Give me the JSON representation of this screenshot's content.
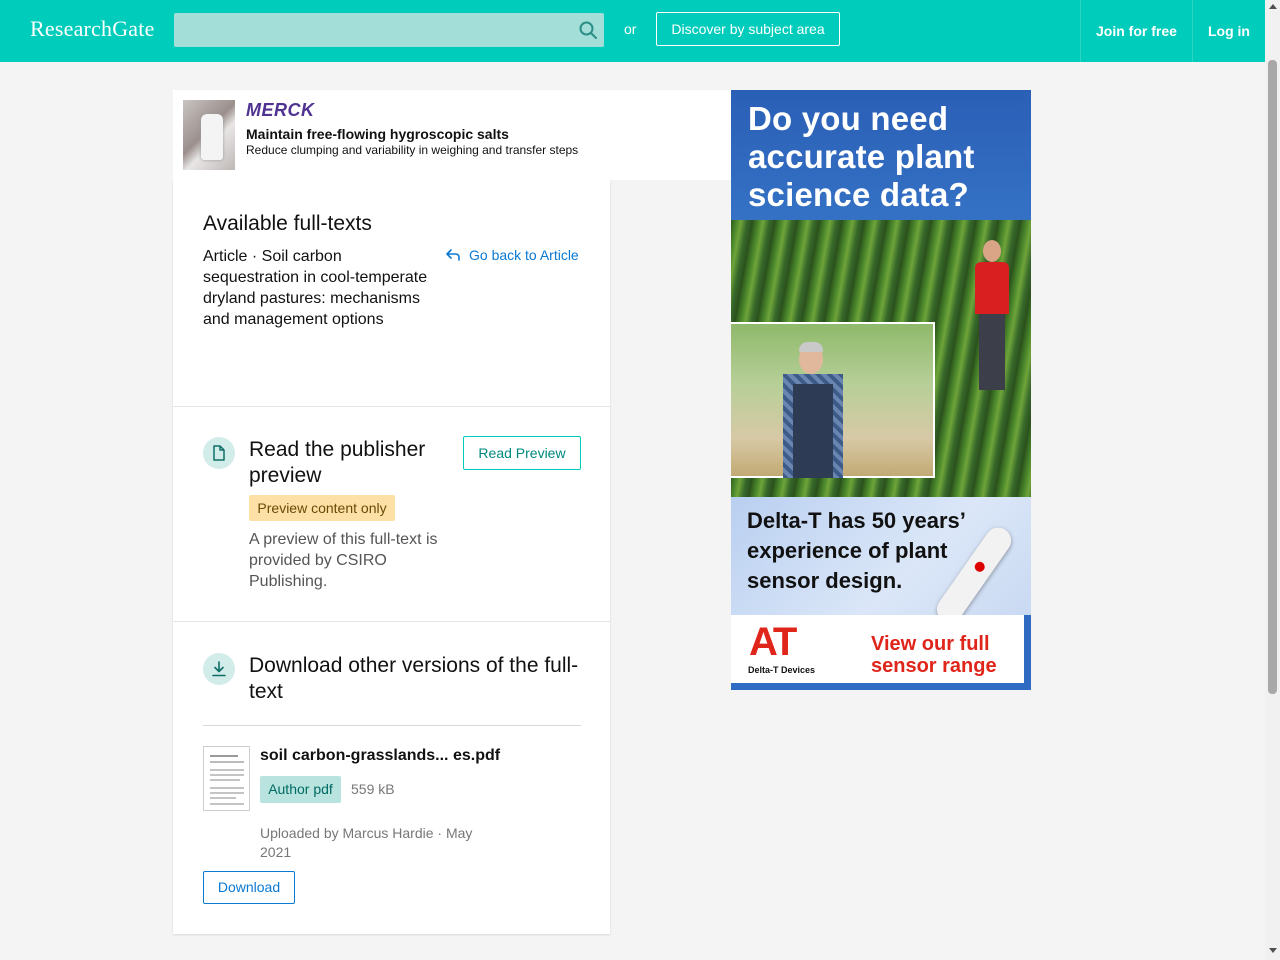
{
  "header": {
    "logo": "ResearchGate",
    "search_placeholder": "",
    "or_text": "or",
    "discover_label": "Discover by subject area",
    "join_label": "Join for free",
    "login_label": "Log in",
    "brand_color": "#00ccbb"
  },
  "top_ad": {
    "brand": "Merck",
    "title": "Maintain free-flowing hygroscopic salts",
    "subtitle": "Reduce clumping and variability in weighing and transfer steps"
  },
  "full_texts": {
    "heading": "Available full-texts",
    "article_description": "Article · Soil carbon sequestration in cool-temperate dryland pastures: mechanisms and management options",
    "go_back_label": "Go back to Article"
  },
  "publisher_preview": {
    "heading": "Read the publisher preview",
    "button_label": "Read Preview",
    "badge": "Preview content only",
    "description": "A preview of this full-text is provided by CSIRO Publishing."
  },
  "downloads": {
    "heading": "Download other versions of the full-text",
    "file": {
      "name": "soil carbon-grasslands... es.pdf",
      "badge": "Author pdf",
      "size": "559 kB",
      "uploaded": "Uploaded by Marcus Hardie · May 2021"
    },
    "download_label": "Download"
  },
  "side_ad": {
    "headline": "Do you need accurate plant science data?",
    "middle_text": "Delta-T has 50 years’ experience of plant sensor design.",
    "logo": "AT",
    "logo_sub": "Delta-T Devices",
    "cta": "View our full sensor range"
  }
}
